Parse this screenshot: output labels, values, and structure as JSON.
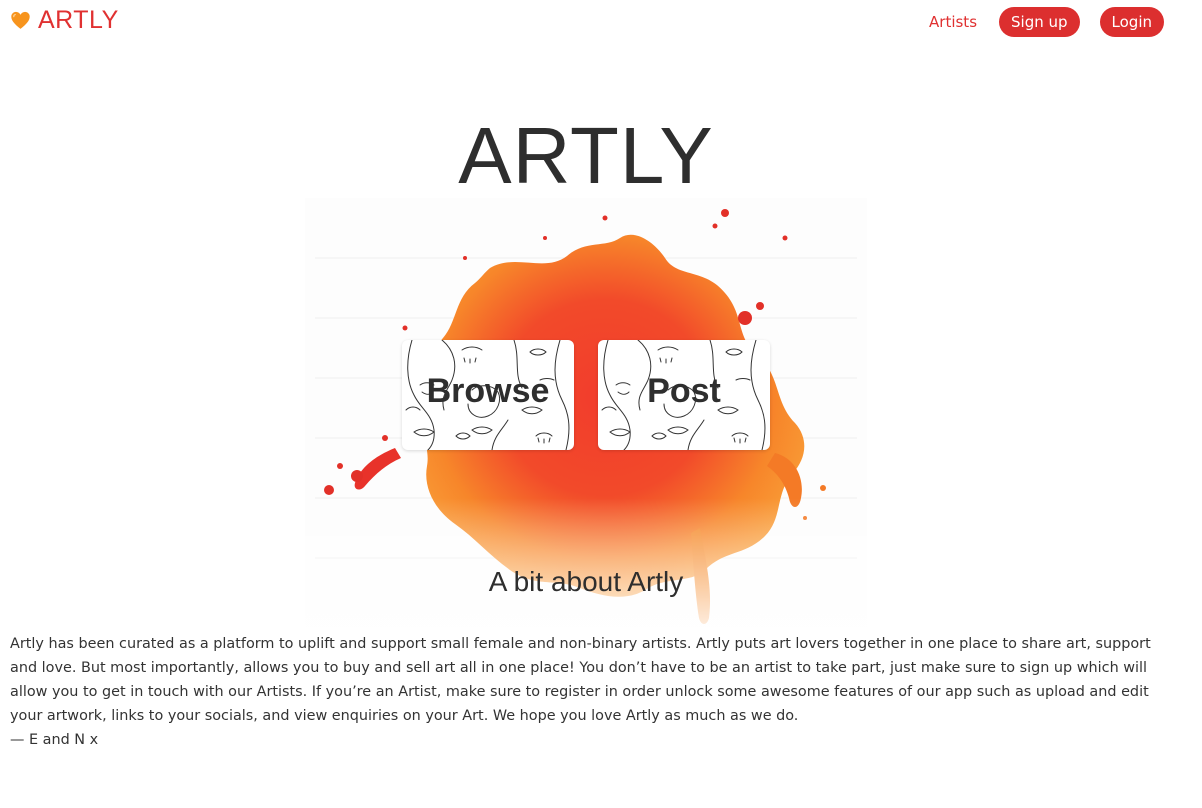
{
  "navbar": {
    "brand": "ARTLY",
    "brand_icon": "orange-heart-icon",
    "links": {
      "artists": "Artists",
      "signup": "Sign up",
      "login": "Login"
    }
  },
  "hero": {
    "title": "ARTLY",
    "tiles": {
      "browse": "Browse",
      "post": "Post"
    }
  },
  "about": {
    "heading": "A bit about Artly",
    "body": "Artly has been curated as a platform to uplift and support small female and non-binary artists. Artly puts art lovers together in one place to share art, support and love. But most importantly, allows you to buy and sell art all in one place! You don’t have to be an artist to take part, just make sure to sign up which will allow you to get in touch with our Artists. If you’re an Artist, make sure to register in order unlock some awesome features of our app such as upload and edit your artwork, links to your socials, and view enquiries on your Art. We hope you love Artly as much as we do.",
    "signature": "— E and N x"
  },
  "colors": {
    "accent": "#e03131",
    "pill": "#dc2f2f",
    "text": "#333333",
    "splash_red": "#f03a2a",
    "splash_orange": "#f7941d"
  }
}
